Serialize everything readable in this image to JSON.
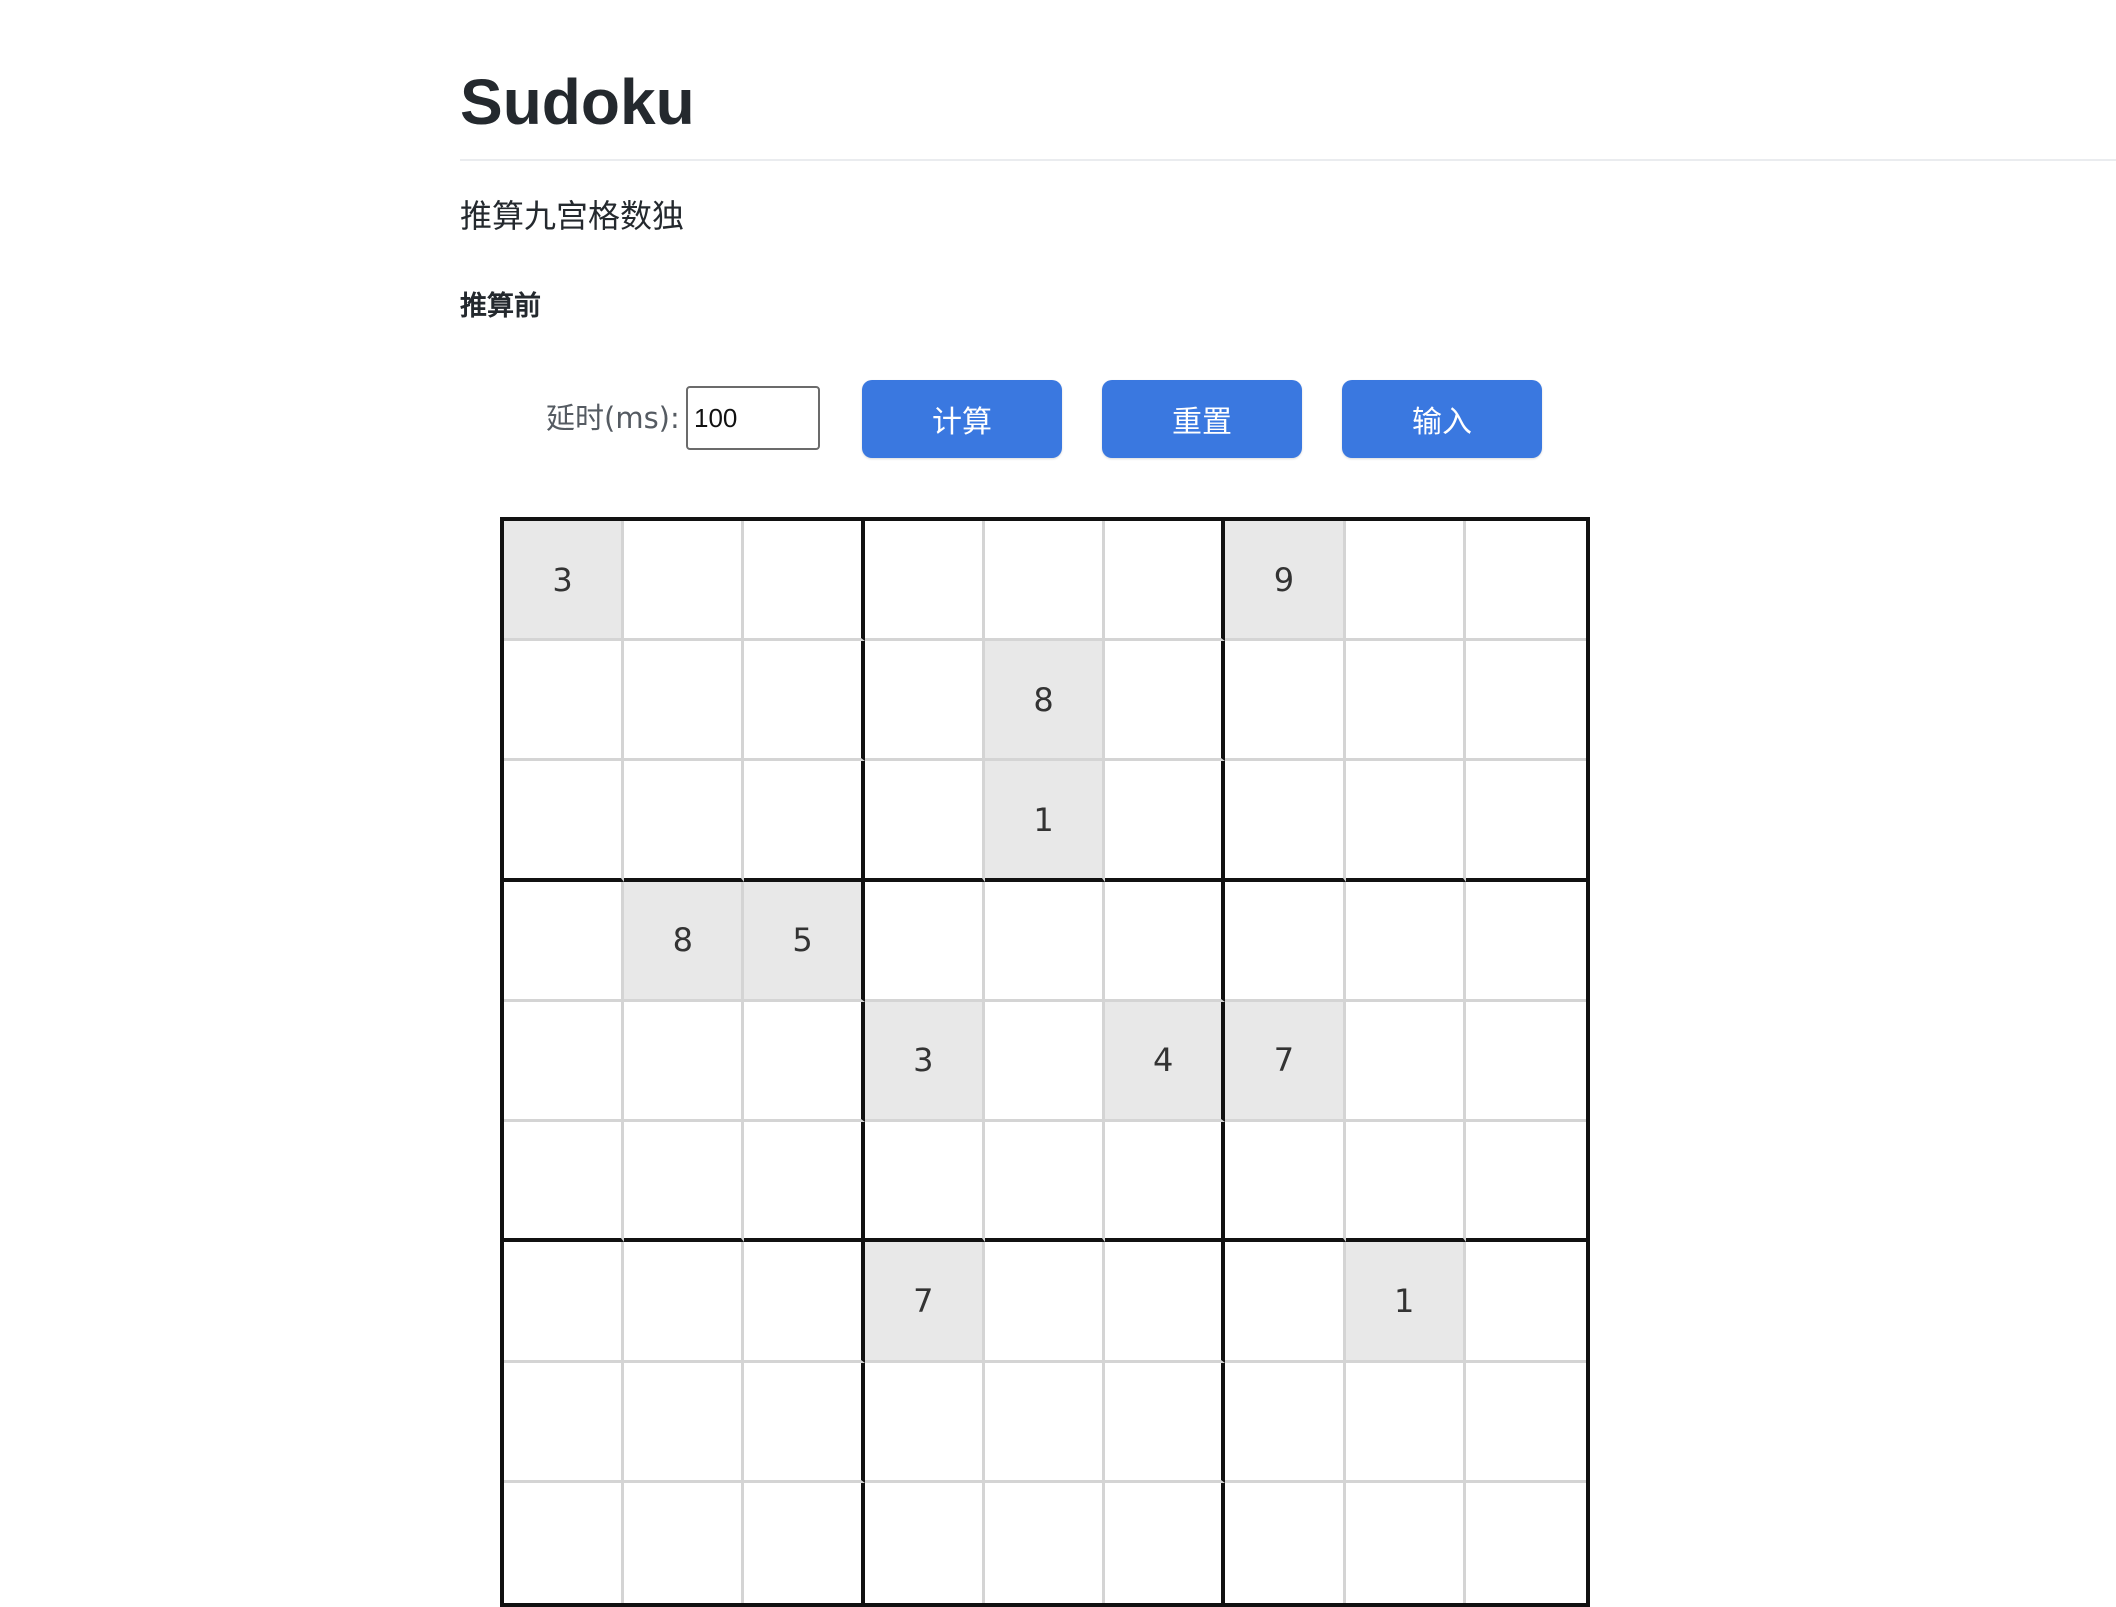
{
  "page": {
    "title": "Sudoku",
    "subtitle": "推算九宫格数独",
    "section_label": "推算前"
  },
  "controls": {
    "delay_label": "延时(ms):",
    "delay_value": "100",
    "calc_button": "计算",
    "reset_button": "重置",
    "input_button": "输入"
  },
  "board": {
    "rows": [
      [
        "3",
        "",
        "",
        "",
        "",
        "",
        "9",
        "",
        ""
      ],
      [
        "",
        "",
        "",
        "",
        "8",
        "",
        "",
        "",
        ""
      ],
      [
        "",
        "",
        "",
        "",
        "1",
        "",
        "",
        "",
        ""
      ],
      [
        "",
        "8",
        "5",
        "",
        "",
        "",
        "",
        "",
        ""
      ],
      [
        "",
        "",
        "",
        "3",
        "",
        "4",
        "7",
        "",
        ""
      ],
      [
        "",
        "",
        "",
        "",
        "",
        "",
        "",
        "",
        ""
      ],
      [
        "",
        "",
        "",
        "7",
        "",
        "",
        "",
        "1",
        ""
      ],
      [
        "",
        "",
        "",
        "",
        "",
        "",
        "",
        "",
        ""
      ],
      [
        "",
        "",
        "",
        "",
        "",
        "",
        "",
        "",
        ""
      ]
    ],
    "given_color": "#e8e8e8"
  },
  "colors": {
    "button": "#3a78e0",
    "button_text": "#ffffff",
    "grid_thick": "#111111",
    "grid_thin": "#d4d4d4"
  }
}
